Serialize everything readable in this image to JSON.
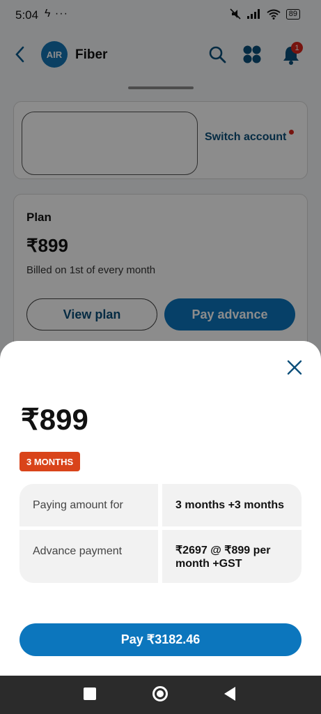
{
  "status_bar": {
    "time": "5:04",
    "extra": "ϟ ···",
    "battery": "89"
  },
  "header": {
    "brand_logo_text": "AIR",
    "title": "Fiber",
    "notification_count": "1"
  },
  "account": {
    "switch_label": "Switch account"
  },
  "plan": {
    "label": "Plan",
    "price": "₹899",
    "billing": "Billed on 1st of every month",
    "view_plan_label": "View plan",
    "pay_advance_label": "Pay advance"
  },
  "sheet": {
    "price": "₹899",
    "duration_badge": "3 MONTHS",
    "details": [
      {
        "label": "Paying amount for",
        "value": "3 months +3 months"
      },
      {
        "label": "Advance payment",
        "value": "₹2697 @ ₹899 per month +GST"
      }
    ],
    "pay_label": "Pay ₹3182.46"
  },
  "colors": {
    "primary": "#0c76bd",
    "badge": "#d9441a",
    "alert": "#d9261c"
  },
  "icons": {
    "back": "back-arrow-icon",
    "search": "search-icon",
    "apps": "apps-grid-icon",
    "bell": "bell-icon",
    "close": "close-icon"
  }
}
